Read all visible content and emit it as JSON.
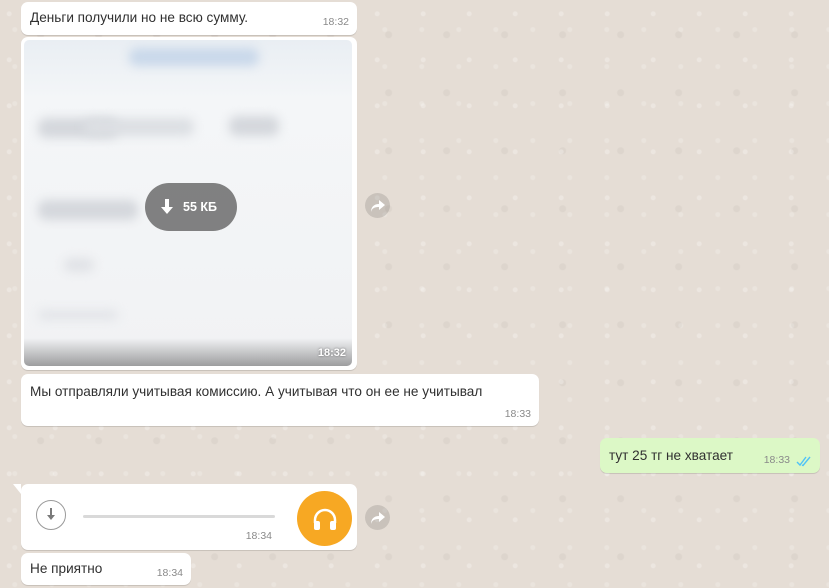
{
  "messages": {
    "m1": {
      "text": "Деньги получили но не всю сумму.",
      "time": "18:32"
    },
    "m2": {
      "size": "55 КБ",
      "time": "18:32"
    },
    "m3": {
      "text": "Мы отправляли учитывая комиссию. А учитывая что он ее не учитывал",
      "time": "18:33"
    },
    "m4": {
      "text": "тут 25 тг не хватает",
      "time": "18:33"
    },
    "m5": {
      "time": "18:34",
      "progress": 0
    },
    "m6": {
      "text": "Не приятно",
      "time": "18:34"
    }
  },
  "colors": {
    "incoming_bubble": "#ffffff",
    "outgoing_bubble": "#dcf8c6",
    "audio_button": "#f7a823",
    "read_ticks": "#4fc3f7",
    "chat_background": "#e5ddd5"
  },
  "icons": [
    "download-icon",
    "forward-icon",
    "headphones-icon",
    "double-check-icon"
  ]
}
